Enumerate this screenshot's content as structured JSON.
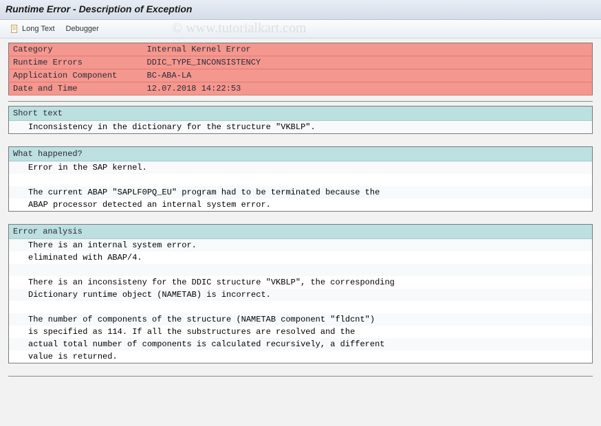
{
  "title": "Runtime Error - Description of Exception",
  "toolbar": {
    "long_text": "Long Text",
    "debugger": "Debugger"
  },
  "summary": {
    "rows": [
      {
        "label": "Category",
        "value": "Internal Kernel Error"
      },
      {
        "label": "Runtime Errors",
        "value": "DDIC_TYPE_INCONSISTENCY"
      },
      {
        "label": "Application Component",
        "value": "BC-ABA-LA"
      },
      {
        "label": "Date and Time",
        "value": "12.07.2018 14:22:53"
      }
    ]
  },
  "sections": [
    {
      "header": "Short text",
      "lines": [
        "Inconsistency in the dictionary for the structure \"VKBLP\"."
      ]
    },
    {
      "header": "What happened?",
      "lines": [
        "Error in the SAP kernel.",
        "",
        "The current ABAP \"SAPLF0PQ_EU\" program had to be terminated because the",
        "ABAP processor detected an internal system error."
      ]
    },
    {
      "header": "Error analysis",
      "lines": [
        "There is an internal system error.",
        "eliminated with ABAP/4.",
        "",
        "There is an inconsisteny for the DDIC structure \"VKBLP\", the corresponding",
        "Dictionary runtime object (NAMETAB) is incorrect.",
        "",
        "The number of components of the structure (NAMETAB component \"fldcnt\")",
        "is specified as 114. If all the substructures are resolved and the",
        "actual total number of components is calculated recursively, a different",
        "value is returned."
      ]
    }
  ],
  "watermark": "© www.tutorialkart.com"
}
